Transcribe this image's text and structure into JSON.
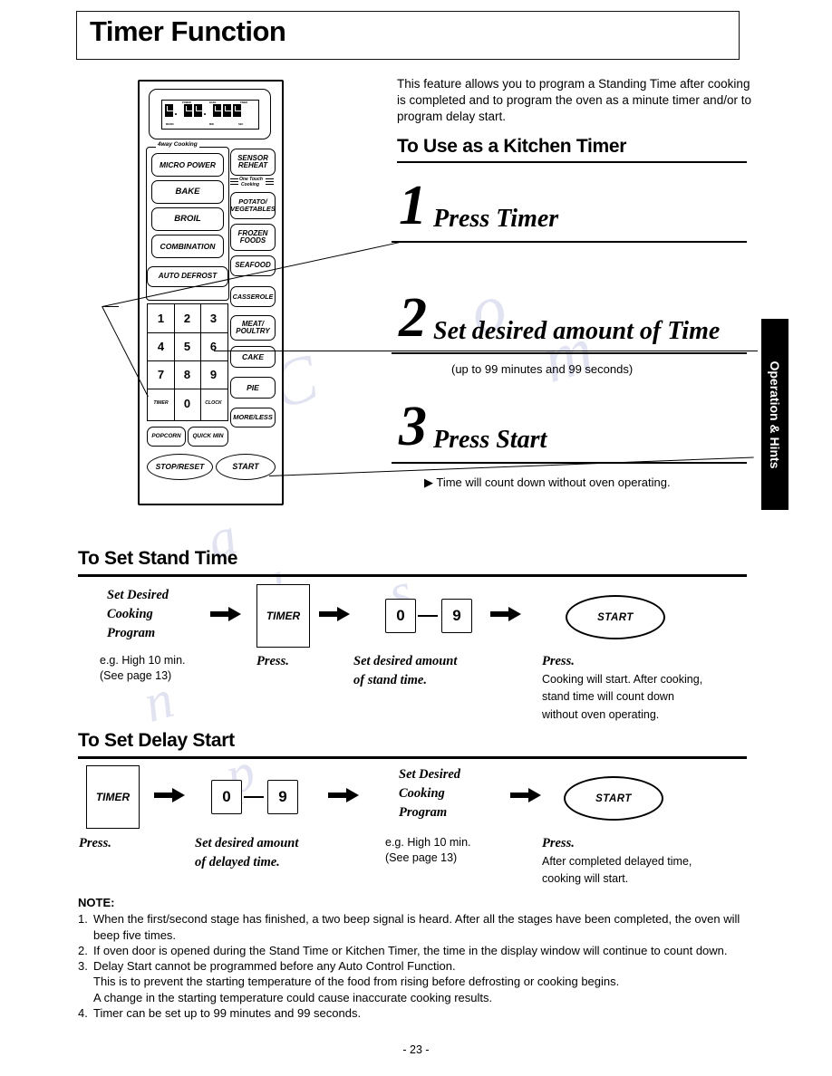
{
  "header": {
    "title": "Timer Function"
  },
  "side_tab": {
    "label": "Operation & Hints"
  },
  "intro": {
    "text": "This feature allows you to program a Standing Time after cooking is completed and to program the oven as a minute timer and/or to program delay start."
  },
  "kitchen_timer": {
    "heading": "To Use as a Kitchen Timer",
    "steps": [
      {
        "num": "1",
        "text": "Press Timer",
        "sub": ""
      },
      {
        "num": "2",
        "text": "Set desired amount of Time",
        "sub": "(up to 99 minutes and 99 seconds)"
      },
      {
        "num": "3",
        "text": "Press Start",
        "sub": "▶ Time will count down without oven operating."
      }
    ]
  },
  "stand_time": {
    "heading": "To Set Stand Time",
    "steps": [
      {
        "key": "Set Desired\nCooking\nProgram",
        "caption": "e.g. High 10 min.\n(See page 13)"
      },
      {
        "key": "TIMER",
        "caption": "Press."
      },
      {
        "key": "0 — 9",
        "caption": "Set desired amount\nof stand time."
      },
      {
        "key": "START",
        "caption": "Press.\nCooking will start. After cooking,\nstand time will count down\nwithout oven operating."
      }
    ],
    "btn_timer": "TIMER",
    "btn_start": "START",
    "digit_from": "0",
    "digit_to": "9",
    "label_program": "Set Desired\nCooking\nProgram",
    "label_program_l1": "Set Desired",
    "label_program_l2": "Cooking",
    "label_program_l3": "Program",
    "cap1_l1": "e.g. High 10 min.",
    "cap1_l2": "(See page 13)",
    "cap2": "Press.",
    "cap3_l1": "Set desired amount",
    "cap3_l2": "of stand time.",
    "cap4_title": "Press.",
    "cap4_l1": "Cooking will start. After cooking,",
    "cap4_l2": "stand time will count down",
    "cap4_l3": "without oven operating."
  },
  "delay_start": {
    "heading": "To Set Delay Start",
    "btn_timer": "TIMER",
    "btn_start": "START",
    "digit_from": "0",
    "digit_to": "9",
    "label_program_l1": "Set Desired",
    "label_program_l2": "Cooking",
    "label_program_l3": "Program",
    "cap1": "Press.",
    "cap2_l1": "Set desired amount",
    "cap2_l2": "of delayed time.",
    "cap3_l1": "e.g. High 10 min.",
    "cap3_l2": "(See page 13)",
    "cap4_title": "Press.",
    "cap4_l1": "After completed delayed time,",
    "cap4_l2": "cooking will start."
  },
  "notes": {
    "title": "NOTE:",
    "items": [
      {
        "n": "1.",
        "text": "When the first/second stage has finished, a two beep signal is heard. After all the stages have been completed, the oven will beep five times."
      },
      {
        "n": "2.",
        "text": "If oven door is opened during the Stand Time or Kitchen Timer, the time in the display window will continue to count down."
      },
      {
        "n": "3.",
        "text": "Delay Start cannot be programmed before any Auto Control Function."
      },
      {
        "n": "4.",
        "text": "Timer can be set up to 99 minutes and 99 seconds."
      }
    ],
    "item3_sub1": "This is to prevent the starting temperature of the food from rising before defrosting or cooking begins.",
    "item3_sub2": "A change in the starting temperature could cause inaccurate cooking results."
  },
  "page_number": "- 23 -",
  "control_panel": {
    "group_label_4way": "4way Cooking",
    "group_label_onetouch_l1": "One Touch",
    "group_label_onetouch_l2": "Cooking",
    "left_buttons": [
      {
        "label": "MICRO POWER"
      },
      {
        "label": "BAKE"
      },
      {
        "label": "BROIL"
      },
      {
        "label": "COMBINATION"
      },
      {
        "label": "AUTO DEFROST"
      }
    ],
    "right_buttons": [
      {
        "label_l1": "SENSOR",
        "label_l2": "REHEAT"
      },
      {
        "label_l1": "POTATO/",
        "label_l2": "VEGETABLES"
      },
      {
        "label_l1": "FROZEN",
        "label_l2": "FOODS"
      },
      {
        "label_l1": "SEAFOOD",
        "label_l2": ""
      },
      {
        "label_l1": "CASSEROLE",
        "label_l2": ""
      },
      {
        "label_l1": "MEAT/",
        "label_l2": "POULTRY"
      },
      {
        "label_l1": "CAKE",
        "label_l2": ""
      },
      {
        "label_l1": "PIE",
        "label_l2": ""
      },
      {
        "label_l1": "MORE/LESS",
        "label_l2": ""
      }
    ],
    "keypad": [
      "1",
      "2",
      "3",
      "4",
      "5",
      "6",
      "7",
      "8",
      "9",
      "TIMER",
      "0",
      "CLOCK"
    ],
    "bottom_buttons": [
      {
        "label": "POPCORN"
      },
      {
        "label": "QUICK MIN"
      },
      {
        "label": "STOP/RESET"
      },
      {
        "label": "START"
      }
    ]
  }
}
